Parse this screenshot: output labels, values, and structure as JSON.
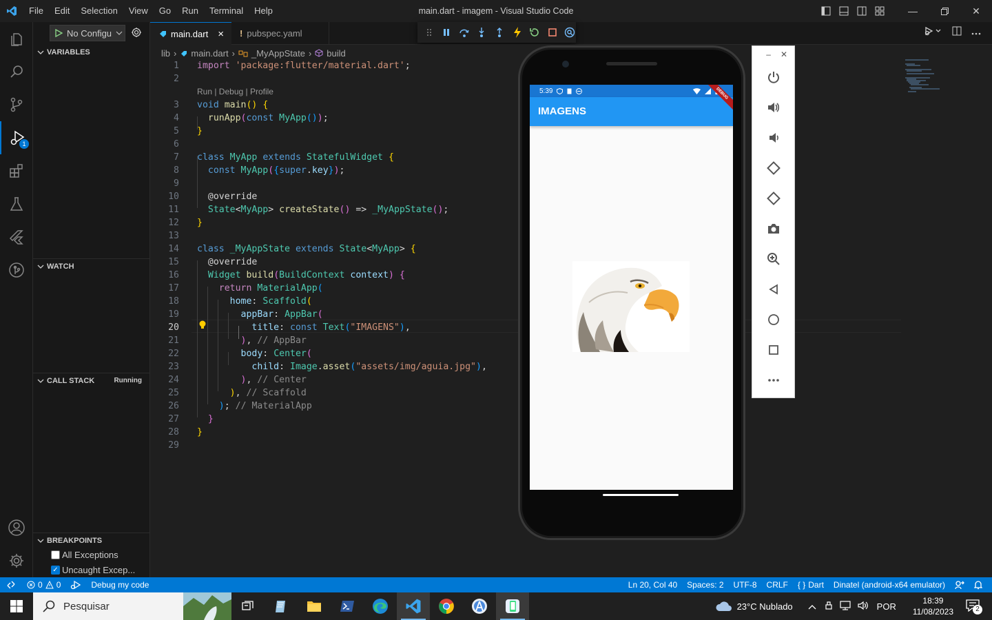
{
  "window": {
    "title": "main.dart - imagem - Visual Studio Code"
  },
  "menu": [
    "File",
    "Edit",
    "Selection",
    "View",
    "Go",
    "Run",
    "Terminal",
    "Help"
  ],
  "sidebar": {
    "config_label": "No Configu",
    "variables": "VARIABLES",
    "watch": "WATCH",
    "callstack": "CALL STACK",
    "callstack_status": "Running",
    "breakpoints": "BREAKPOINTS",
    "bp_all": "All Exceptions",
    "bp_uncaught": "Uncaught Excep...",
    "debug_badge": "1"
  },
  "tabs": [
    {
      "label": "main.dart",
      "close": "×"
    },
    {
      "label": "pubspec.yaml",
      "mark": "!"
    }
  ],
  "breadcrumb": {
    "lib": "lib",
    "file": "main.dart",
    "class": "_MyAppState",
    "method": "build"
  },
  "codelens": "Run | Debug | Profile",
  "lines": [
    "1",
    "2",
    "3",
    "4",
    "5",
    "6",
    "7",
    "8",
    "9",
    "10",
    "11",
    "12",
    "13",
    "14",
    "15",
    "16",
    "17",
    "18",
    "19",
    "20",
    "21",
    "22",
    "23",
    "24",
    "25",
    "26",
    "27",
    "28",
    "29"
  ],
  "phone": {
    "time": "5:39",
    "appbar_title": "IMAGENS",
    "debug_banner": "DEBUG"
  },
  "statusbar": {
    "errors": "0",
    "warnings": "0",
    "debug": "Debug my code",
    "position": "Ln 20, Col 40",
    "spaces": "Spaces: 2",
    "encoding": "UTF-8",
    "eol": "CRLF",
    "language": "Dart",
    "device": "Dinatel (android-x64 emulator)"
  },
  "taskbar": {
    "search": "Pesquisar",
    "weather": "23°C  Nublado",
    "lang": "POR",
    "time": "18:39",
    "date": "11/08/2023",
    "notif": "2"
  },
  "colors": {
    "accent": "#0078d4",
    "appbar": "#2196f3"
  }
}
